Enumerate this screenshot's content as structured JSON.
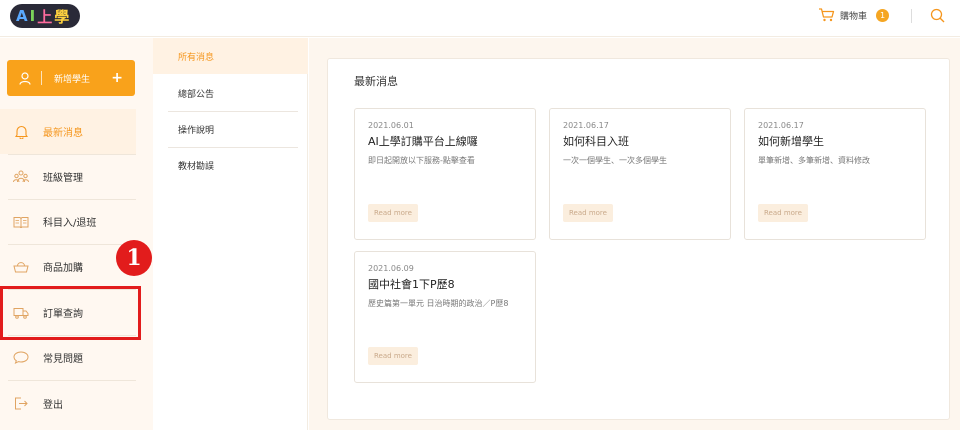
{
  "header": {
    "logo": [
      "A",
      "I",
      "上",
      "學"
    ],
    "cart_label": "購物車",
    "cart_count": "1"
  },
  "sidebar": {
    "add_student_label": "新增學生",
    "add_icon": "+",
    "items": [
      {
        "label": "最新消息",
        "icon": "bell-icon",
        "active": true
      },
      {
        "label": "班級管理",
        "icon": "people-icon"
      },
      {
        "label": "科目入/退班",
        "icon": "book-icon"
      },
      {
        "label": "商品加購",
        "icon": "basket-icon"
      },
      {
        "label": "訂單查詢",
        "icon": "truck-icon"
      },
      {
        "label": "常見問題",
        "icon": "chat-icon"
      },
      {
        "label": "登出",
        "icon": "logout-icon"
      }
    ],
    "step_marker": "1"
  },
  "subnav": {
    "items": [
      "所有消息",
      "總部公告",
      "操作說明",
      "教材勘誤"
    ]
  },
  "main": {
    "panel_title": "最新消息",
    "cards": [
      {
        "date": "2021.06.01",
        "title": "AI上學訂購平台上線囉",
        "desc": "即日起開放以下服務-點擊查看",
        "more": "Read more"
      },
      {
        "date": "2021.06.17",
        "title": "如何科目入班",
        "desc": "一次一個學生、一次多個學生",
        "more": "Read more"
      },
      {
        "date": "2021.06.17",
        "title": "如何新增學生",
        "desc": "單筆新增、多筆新增、資料修改",
        "more": "Read more"
      },
      {
        "date": "2021.06.09",
        "title": "國中社會1下P歷8",
        "desc": "歷史篇第一單元 日治時期的政治／P歷8",
        "more": "Read more"
      }
    ]
  },
  "colors": {
    "accent": "#f9a21b",
    "highlight": "#e21c1c"
  }
}
